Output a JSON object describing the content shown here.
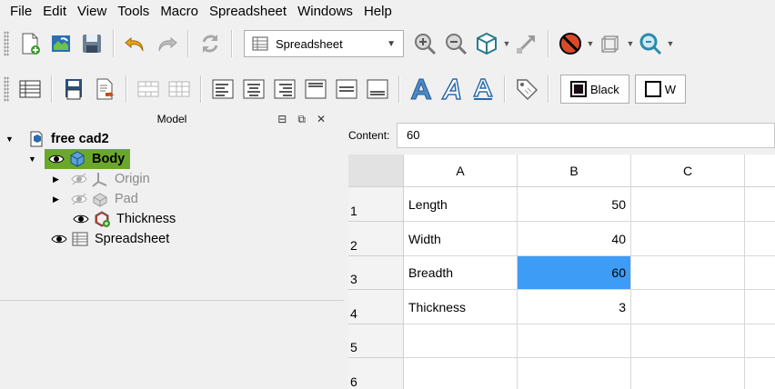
{
  "menu": [
    "File",
    "Edit",
    "View",
    "Tools",
    "Macro",
    "Spreadsheet",
    "Windows",
    "Help"
  ],
  "toolbar": {
    "workbench": "Spreadsheet",
    "colors": {
      "foreground_label": "Black",
      "background_label_partial": "W"
    }
  },
  "model": {
    "title": "Model",
    "tree": {
      "document": "free cad2",
      "body": "Body",
      "origin": "Origin",
      "pad": "Pad",
      "thickness": "Thickness",
      "spreadsheet": "Spreadsheet"
    },
    "highlight_color": "#6aa82b"
  },
  "sheet": {
    "content_label": "Content:",
    "content_value": "60",
    "columns": [
      "A",
      "B",
      "C"
    ],
    "rows": [
      {
        "num": "1",
        "a": "Length",
        "b": "50"
      },
      {
        "num": "2",
        "a": "Width",
        "b": "40"
      },
      {
        "num": "3",
        "a": "Breadth",
        "b": "60"
      },
      {
        "num": "4",
        "a": "Thickness",
        "b": "3"
      },
      {
        "num": "5",
        "a": "",
        "b": ""
      },
      {
        "num": "6",
        "a": "",
        "b": ""
      }
    ],
    "selected_cell": "B3",
    "selection_color": "#3d9cf5"
  }
}
